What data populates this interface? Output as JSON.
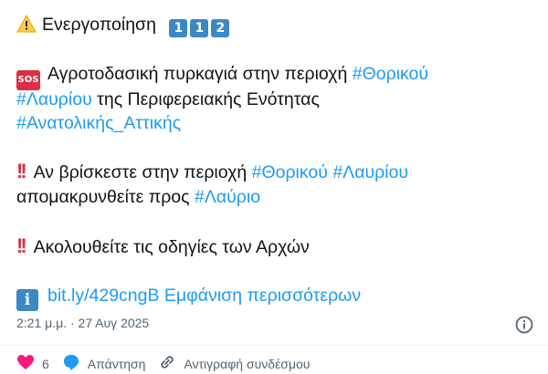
{
  "tweet": {
    "line1": {
      "text": "Ενεργοποίηση",
      "digits": [
        "1",
        "1",
        "2"
      ]
    },
    "sos_label": "SOS",
    "paragraph1": {
      "pre": "Αγροτοδασική πυρκαγιά στην περιοχή",
      "tag1": "#Θορικού",
      "tag2": "#Λαυρίου",
      "mid": "της Περιφερειακής Ενότητας",
      "tag3": "#Ανατολικής_Αττικής"
    },
    "bang_symbol": "!!",
    "paragraph2": {
      "pre": "Αν βρίσκεστε στην περιοχή",
      "tag1": "#Θορικού",
      "tag2": "#Λαυρίου",
      "line2_pre": "απομακρυνθείτε προς",
      "tag3": "#Λαύριο"
    },
    "paragraph3": {
      "text": "Ακολουθείτε τις οδηγίες των Αρχών"
    },
    "info_letter": "i",
    "link": {
      "url_text": "bit.ly/429cngB",
      "more_text": "Εμφάνιση περισσότερων"
    },
    "timestamp": "2:21 μ.μ. · 27 Αυγ 2025"
  },
  "actions": {
    "like_count": "6",
    "reply_label": "Απάντηση",
    "copy_label": "Αντιγραφή συνδέσμου"
  },
  "colors": {
    "link": "#1d9bf0",
    "text": "#0f1419",
    "muted": "#536471",
    "keycap": "#3b88c3",
    "alert": "#dd2e44"
  },
  "icons": [
    "warning-icon",
    "keycap-1-icon",
    "keycap-2-icon",
    "sos-icon",
    "double-exclamation-icon",
    "information-icon",
    "info-circle-icon",
    "heart-icon",
    "reply-icon",
    "link-icon"
  ]
}
